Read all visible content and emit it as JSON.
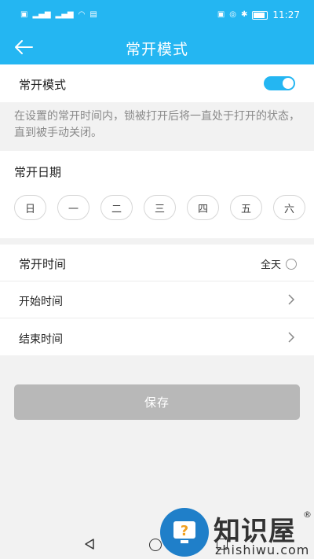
{
  "status_bar": {
    "left_icons": [
      "HD",
      "4G",
      "4G",
      "wifi",
      "signal"
    ],
    "right_icons": [
      "nfc",
      "alarm",
      "bluetooth"
    ],
    "time": "11:27"
  },
  "header": {
    "title": "常开模式",
    "back_icon": "arrow-left-icon"
  },
  "mode": {
    "label": "常开模式",
    "enabled": true,
    "description": "在设置的常开时间内，锁被打开后将一直处于打开的状态，直到被手动关闭。"
  },
  "dates": {
    "label": "常开日期",
    "days": [
      "日",
      "一",
      "二",
      "三",
      "四",
      "五",
      "六"
    ]
  },
  "time": {
    "label": "常开时间",
    "all_day_label": "全天",
    "all_day_selected": false,
    "start_label": "开始时间",
    "end_label": "结束时间"
  },
  "save_label": "保存",
  "watermark": {
    "title": "知识屋",
    "url": "zhishiwu.com",
    "reg": "®"
  },
  "colors": {
    "primary": "#24b6f2",
    "disabled_button": "#b8b8b8",
    "background": "#f2f2f2"
  }
}
